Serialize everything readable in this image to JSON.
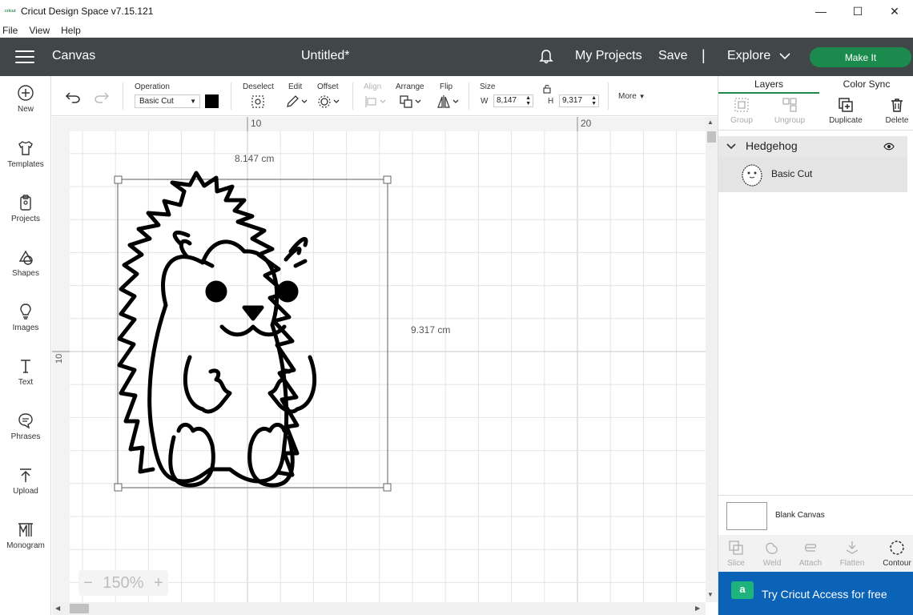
{
  "window": {
    "title": "Cricut Design Space  v7.15.121",
    "icon_text": "cricut",
    "minimize": "—",
    "maximize": "☐",
    "close": "✕"
  },
  "menu": [
    "File",
    "View",
    "Help"
  ],
  "header": {
    "section": "Canvas",
    "doc_title": "Untitled*",
    "my_projects": "My Projects",
    "save": "Save",
    "separator": "|",
    "explore": "Explore",
    "make_it": "Make It"
  },
  "leftnav": [
    {
      "label": "New",
      "icon": "plus-circle-icon"
    },
    {
      "label": "Templates",
      "icon": "shirt-icon"
    },
    {
      "label": "Projects",
      "icon": "clipboard-icon"
    },
    {
      "label": "Shapes",
      "icon": "shapes-icon"
    },
    {
      "label": "Images",
      "icon": "bulb-icon"
    },
    {
      "label": "Text",
      "icon": "text-icon"
    },
    {
      "label": "Phrases",
      "icon": "speech-icon"
    },
    {
      "label": "Upload",
      "icon": "upload-icon"
    },
    {
      "label": "Monogram",
      "icon": "monogram-icon"
    }
  ],
  "toolbar": {
    "operation_label": "Operation",
    "operation_value": "Basic Cut",
    "deselect": "Deselect",
    "edit": "Edit",
    "offset": "Offset",
    "align": "Align",
    "arrange": "Arrange",
    "flip": "Flip",
    "size": "Size",
    "w_label": "W",
    "w_value": "8,147",
    "h_label": "H",
    "h_value": "9,317",
    "more": "More"
  },
  "canvas": {
    "ruler_top": [
      "10",
      "20"
    ],
    "ruler_left": [
      "10"
    ],
    "width_readout": "8.147 cm",
    "height_readout": "9.317 cm",
    "zoom_minus": "−",
    "zoom": "150%",
    "zoom_plus": "+"
  },
  "layers_panel": {
    "tabs": [
      "Layers",
      "Color Sync"
    ],
    "tools": [
      "Group",
      "Ungroup",
      "Duplicate",
      "Delete"
    ],
    "group_name": "Hedgehog",
    "layer_name": "Basic Cut",
    "blank_canvas": "Blank Canvas",
    "bottom_tools": [
      "Slice",
      "Weld",
      "Attach",
      "Flatten",
      "Contour"
    ],
    "access_badge": "a",
    "access_cta": "Try Cricut Access for free"
  },
  "colors": {
    "header_bg": "#414649",
    "make_it": "#1b8a4d",
    "access_bg": "#0b63b8"
  }
}
